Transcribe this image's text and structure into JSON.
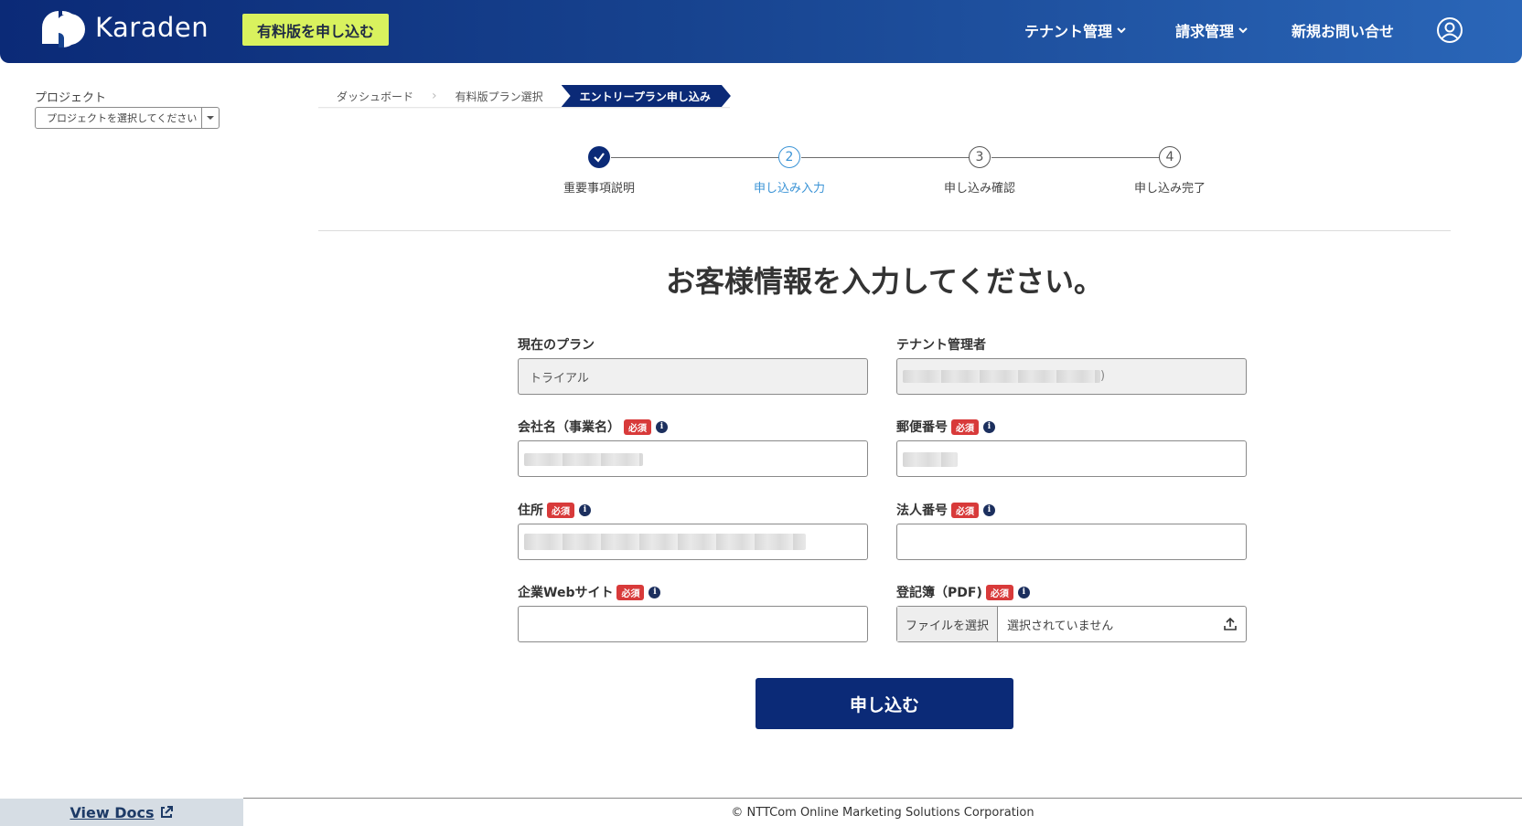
{
  "header": {
    "brand": "Karaden",
    "upgrade_label": "有料版を申し込む",
    "nav": [
      {
        "label": "テナント管理"
      },
      {
        "label": "請求管理"
      },
      {
        "label": "新規お問い合せ"
      }
    ],
    "user_icon": "user-circle-icon"
  },
  "sidebar": {
    "project_label": "プロジェクト",
    "project_select_value": "プロジェクトを選択してください",
    "view_docs": "View Docs"
  },
  "breadcrumb": [
    {
      "label": "ダッシュボード"
    },
    {
      "label": "有料版プラン選択"
    },
    {
      "label": "エントリープラン申し込み"
    }
  ],
  "stepper": {
    "steps": [
      {
        "number": "✓",
        "label": "重要事項説明",
        "state": "done"
      },
      {
        "number": "2",
        "label": "申し込み入力",
        "state": "current"
      },
      {
        "number": "3",
        "label": "申し込み確認",
        "state": "todo"
      },
      {
        "number": "4",
        "label": "申し込み完了",
        "state": "todo"
      }
    ]
  },
  "title": "お客様情報を入力してください。",
  "form": {
    "required_badge": "必須",
    "info_glyph": "i",
    "current_plan": {
      "label": "現在のプラン",
      "value": "トライアル"
    },
    "tenant_admin": {
      "label": "テナント管理者",
      "value_suffix": ")"
    },
    "company_name": {
      "label": "会社名（事業名）"
    },
    "postal_code": {
      "label": "郵便番号"
    },
    "address": {
      "label": "住所"
    },
    "corporate_number": {
      "label": "法人番号"
    },
    "website": {
      "label": "企業Webサイト"
    },
    "registry_pdf": {
      "label": "登記簿（PDF)",
      "choose_file": "ファイルを選択",
      "no_file": "選択されていません"
    },
    "submit_label": "申し込む"
  },
  "footer": {
    "copyright": "© NTTCom Online Marketing Solutions Corporation"
  },
  "colors": {
    "primary": "#0b2a77",
    "accent_lime": "#d9f25e",
    "step_current": "#3a93d6",
    "required": "#d83a3a"
  }
}
